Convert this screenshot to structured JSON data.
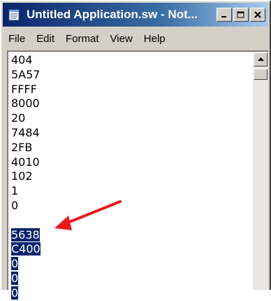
{
  "window": {
    "title": "Untitled Application.sw - Not...",
    "controls": {
      "minimize": "minimize-icon",
      "maximize": "maximize-icon",
      "close": "close-icon"
    }
  },
  "menu": {
    "items": [
      {
        "label": "File"
      },
      {
        "label": "Edit"
      },
      {
        "label": "Format"
      },
      {
        "label": "View"
      },
      {
        "label": "Help"
      }
    ]
  },
  "editor": {
    "lines": [
      {
        "text": "404",
        "selected": false
      },
      {
        "text": "5A57",
        "selected": false
      },
      {
        "text": "FFFF",
        "selected": false
      },
      {
        "text": "8000",
        "selected": false
      },
      {
        "text": "20",
        "selected": false
      },
      {
        "text": "7484",
        "selected": false
      },
      {
        "text": "2FB",
        "selected": false
      },
      {
        "text": "4010",
        "selected": false
      },
      {
        "text": "102",
        "selected": false
      },
      {
        "text": "1",
        "selected": false
      },
      {
        "text": "0",
        "selected": false
      },
      {
        "text": "",
        "selected": false
      },
      {
        "text": "5638",
        "selected": true
      },
      {
        "text": "C400",
        "selected": true
      },
      {
        "text": "0",
        "selected": true
      },
      {
        "text": "0",
        "selected": true
      },
      {
        "text": "0",
        "selected": true
      }
    ]
  },
  "annotation": {
    "arrow_color": "#e8191a",
    "icon": "red-arrow-icon"
  },
  "colors": {
    "selection_bg": "#0a246a",
    "selection_text": "#ffffff",
    "titlebar_start": "#0a246a",
    "titlebar_end": "#a6caf0"
  }
}
